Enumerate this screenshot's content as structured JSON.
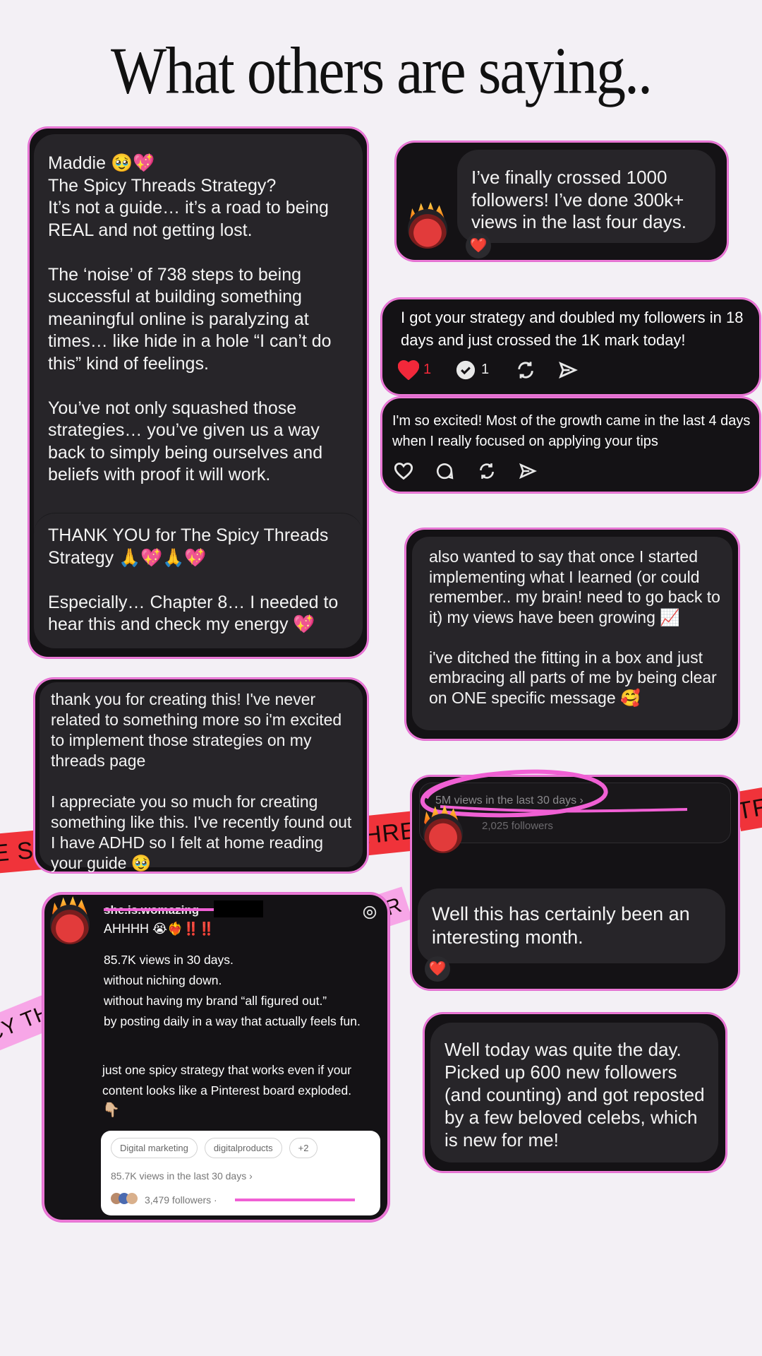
{
  "title": "What others are saying..",
  "card1": {
    "text": "Maddie 🥹💖\nThe Spicy Threads Strategy?\nIt’s not a guide… it’s a road to being REAL and not getting lost.\n\nThe ‘noise’ of 738 steps to being successful at building something meaningful online is paralyzing at times… like hide in a hole “I can’t do this” kind of feelings.\n\nYou’ve not only squashed those strategies… you’ve given us a way back to simply being ourselves and beliefs with proof it will work.",
    "text2": "THANK YOU for The Spicy Threads Strategy 🙏💖🙏💖\n\nEspecially… Chapter 8… I needed to hear this and check my energy 💖"
  },
  "card2": {
    "text": "I’ve finally crossed 1000 followers! I’ve done 300k+ views in the last four days.",
    "reaction": "❤️"
  },
  "card3": {
    "text": "I got your strategy and doubled my followers in 18 days and just crossed the 1K mark today!",
    "likes": "1",
    "replies": "1"
  },
  "card4": {
    "text": "I'm so excited! Most of the growth came in the last 4 days when I really focused on applying your tips"
  },
  "card5": {
    "text": "also wanted to say that once I started implementing what I learned  (or could remember.. my brain! need to go back to it) my views have been growing 📈\n\ni've ditched the fitting in a box and just embracing all parts of me by being clear on ONE specific message 🥰"
  },
  "card6": {
    "text": "thank you for creating this! I've never related to something more so i'm excited to implement those strategies on my threads page\n\nI appreciate you so much for creating something like this. I've recently found out I have ADHD so I felt at home reading your guide 🥹"
  },
  "card7": {
    "stat": "5M views in the last 30 days ›",
    "sub": "2,025 followers",
    "text": "Well this has certainly been an interesting month.",
    "reaction": "❤️"
  },
  "card8": {
    "username": "she.is.womazing",
    "line1": "AHHHH 😭❤️‍🔥‼️‼️",
    "line2": "85.7K views in 30 days.\nwithout niching down.\nwithout having my brand “all figured out.”\nby posting daily in a way that actually feels fun.",
    "line3": "just one spicy strategy that works even if your content looks like a Pinterest board exploded.",
    "pointer": "👇🏼",
    "chips": [
      "Digital marketing",
      "digitalproducts",
      "+2"
    ],
    "views": "85.7K views in the last 30 days ›",
    "followers": "3,479 followers ·"
  },
  "card9": {
    "text": "Well today was quite the day. Picked up 600 new followers (and counting) and got reposted by a few beloved celebs, which is new for me!"
  },
  "banner": {
    "left": "E SP",
    "mid": "HREA",
    "right": "TRA",
    "pink_mid": "TR",
    "pink_left": "CY TH"
  }
}
